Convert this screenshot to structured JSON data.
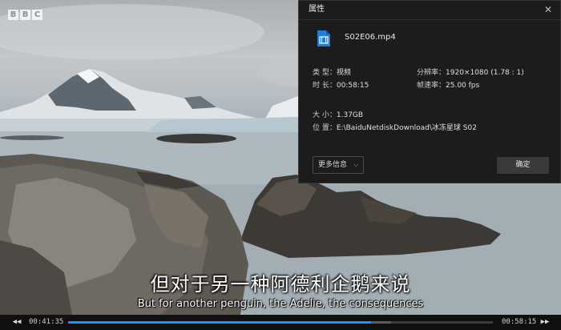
{
  "video": {
    "logo_letters": [
      "B",
      "B",
      "C"
    ],
    "subtitle_cn": "但对于另一种阿德利企鹅来说",
    "subtitle_en": "But for another penguin, the Adelie, the consequences"
  },
  "dialog": {
    "title": "属性",
    "file_name": "S02E06.mp4",
    "props": {
      "type_label": "类 型：",
      "type_value": "视频",
      "resolution_label": "分辨率：",
      "resolution_value": "1920×1080 (1.78 : 1)",
      "duration_label": "时 长：",
      "duration_value": "00:58:15",
      "framerate_label": "帧速率：",
      "framerate_value": "25.00 fps",
      "size_label": "大 小：",
      "size_value": "1.37GB",
      "location_label": "位 置：",
      "location_value": "E:\\BaiduNetdiskDownload\\冰冻星球 S02"
    },
    "more_button": "更多信息",
    "ok_button": "确定"
  },
  "player": {
    "current_time": "00:41:35",
    "total_time": "00:58:15",
    "progress_fraction": 0.714,
    "buffer_fraction": 0.76,
    "accent_color": "#1f8fff"
  }
}
